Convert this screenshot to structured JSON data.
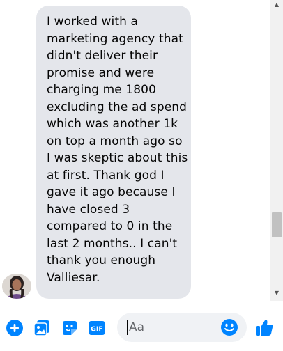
{
  "message": {
    "lines": [
      "I worked with a",
      "marketing agency that",
      "didn't deliver their",
      "promise and were",
      "charging me 1800",
      "excluding the ad spend",
      "which was another 1k",
      "on top a month ago so",
      "I was skeptic about this",
      "at first. Thank god I",
      "gave it ago because I",
      "have closed 3",
      "compared to 0 in the",
      "last 2 months.. I can't",
      "thank you enough",
      "Valliesar."
    ]
  },
  "composer": {
    "placeholder": "Aa",
    "gif_label": "GIF",
    "icons": [
      "plus-icon",
      "photo-icon",
      "sticker-icon",
      "gif-icon",
      "emoji-icon",
      "like-icon"
    ]
  },
  "colors": {
    "accent": "#0084ff",
    "bubble": "#e4e6eb",
    "input_bg": "#f0f2f5"
  }
}
